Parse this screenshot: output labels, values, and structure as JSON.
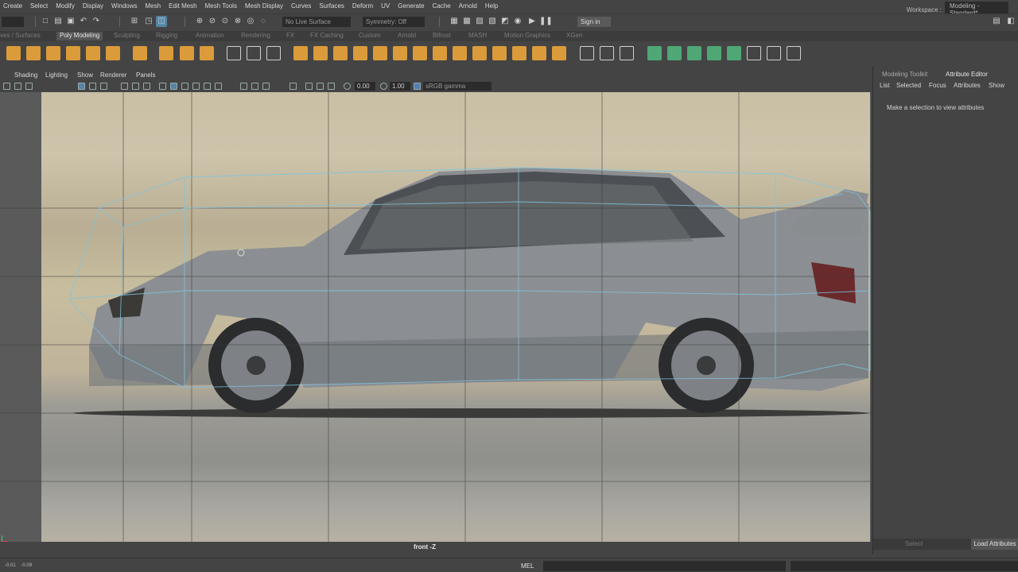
{
  "menubar": {
    "items": [
      "Create",
      "Select",
      "Modify",
      "Display",
      "Windows",
      "Mesh",
      "Edit Mesh",
      "Mesh Tools",
      "Mesh Display",
      "Curves",
      "Surfaces",
      "Deform",
      "UV",
      "Generate",
      "Cache",
      "Arnold",
      "Help"
    ]
  },
  "workspace": {
    "label": "Workspace :",
    "value": "Modeling - Standard*"
  },
  "statusline": {
    "live_surface": "No Live Surface",
    "symmetry": "Symmetry: Off",
    "sign_in": "Sign in"
  },
  "shelf_tabs": [
    "ves / Surfaces",
    "Poly Modeling",
    "Sculpting",
    "Rigging",
    "Animation",
    "Rendering",
    "FX",
    "FX Caching",
    "Custom",
    "Arnold",
    "Bifrost",
    "MASH",
    "Motion Graphics",
    "XGen"
  ],
  "shelf_active_tab": "Poly Modeling",
  "panel_menu": [
    "Shading",
    "Lighting",
    "Show",
    "Renderer",
    "Panels"
  ],
  "panel_toolbar": {
    "field1": "0.00",
    "field2": "1.00",
    "color_space": "sRGB gamma"
  },
  "viewport": {
    "camera_label": "front -Z"
  },
  "right_panel": {
    "tabs": [
      "Modeling Toolkit",
      "Attribute Editor"
    ],
    "active_tab": "Attribute Editor",
    "menu": [
      "List",
      "Selected",
      "Focus",
      "Attributes",
      "Show"
    ],
    "message": "Make a selection to view attributes",
    "select_label": "Select",
    "load_button": "Load Attributes"
  },
  "command_line": {
    "coords": [
      "-0.01",
      "-0.09"
    ],
    "language": "MEL"
  },
  "colors": {
    "accent_orange": "#e8a33a",
    "accent_green": "#4fb07a",
    "wire_blue": "#7fc4e0"
  }
}
